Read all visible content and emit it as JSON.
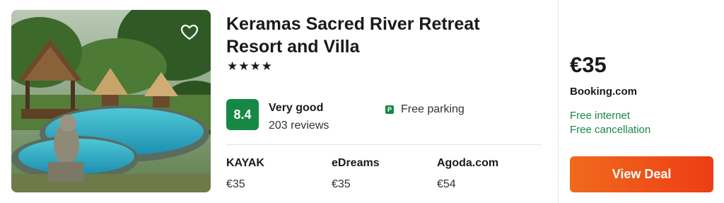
{
  "hotel": {
    "name": "Keramas Sacred River Retreat Resort and Villa",
    "stars": "★★★★",
    "rating": {
      "score": "8.4",
      "label": "Very good",
      "reviews": "203 reviews",
      "color": "#168845"
    },
    "amenity": {
      "icon": "parking-icon",
      "icon_glyph": "P",
      "text": "Free parking"
    }
  },
  "providers": [
    {
      "name": "KAYAK",
      "price": "€35"
    },
    {
      "name": "eDreams",
      "price": "€35"
    },
    {
      "name": "Agoda.com",
      "price": "€54"
    }
  ],
  "deal": {
    "price": "€35",
    "provider": "Booking.com",
    "features": [
      "Free internet",
      "Free cancellation"
    ],
    "feature_color": "#168845",
    "button_label": "View Deal",
    "button_color": "#ee4a17"
  },
  "icons": {
    "favorite": "heart-icon"
  }
}
